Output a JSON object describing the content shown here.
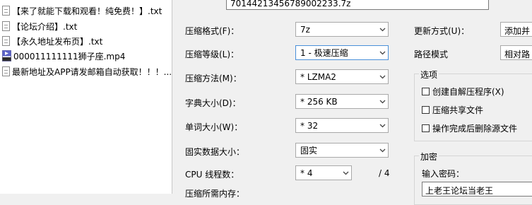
{
  "files": [
    {
      "name": "【来了就能下载和观看！纯免费！】.txt",
      "icon": "txt-file-icon"
    },
    {
      "name": "【论坛介绍】.txt",
      "icon": "txt-file-icon"
    },
    {
      "name": "【永久地址发布页】.txt",
      "icon": "txt-file-icon"
    },
    {
      "name": "000011111111狮子座.mp4",
      "icon": "mp4-file-icon"
    },
    {
      "name": "最新地址及APP请发邮箱自动获取！！！...",
      "icon": "txt-file-icon"
    }
  ],
  "archive_name": "70144213456789002233.7z",
  "settings": {
    "format_label": "压缩格式(F)：",
    "format_value": "7z",
    "level_label": "压缩等级(L)：",
    "level_value": "1 - 极速压缩",
    "method_label": "压缩方法(M)：",
    "method_value": "* LZMA2",
    "dict_label": "字典大小(D)：",
    "dict_value": "* 256 KB",
    "word_label": "单词大小(W)：",
    "word_value": "* 32",
    "solid_label": "固实数据大小：",
    "solid_value": "固实",
    "cpu_label": "CPU 线程数：",
    "cpu_value": "* 4",
    "cpu_total": "/ 4",
    "memory_label": "压缩所需内存："
  },
  "right": {
    "update_label": "更新方式(U)：",
    "update_value": "添加并",
    "path_label": "路径模式",
    "path_value": "相对路",
    "options_title": "选项",
    "opt_sfx": "创建自解压程序(X)",
    "opt_shared": "压缩共享文件",
    "opt_delete": "操作完成后删除源文件",
    "encrypt_title": "加密",
    "password_label": "输入密码：",
    "password_value": "上老王论坛当老王"
  },
  "colors": {
    "accent_border": "#4a90d9",
    "window_bg": "#f0f0f0"
  }
}
